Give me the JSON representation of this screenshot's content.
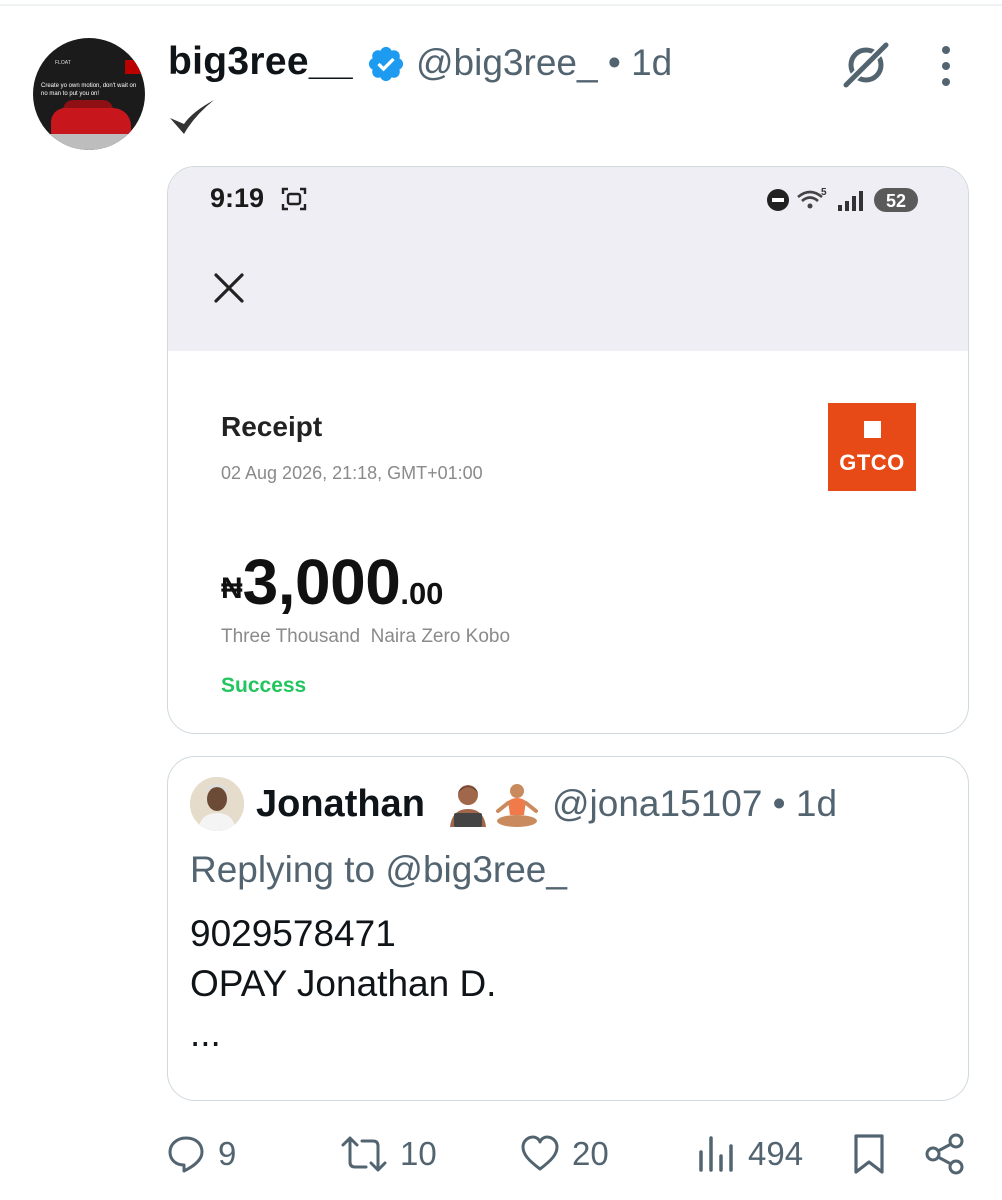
{
  "tweet": {
    "name": "big3ree__",
    "handle_time": "@big3ree_ • 1d",
    "avatar_caption": "Create yo own motion, don't wait on no man to put you on!",
    "avatar_name": "FLOAT"
  },
  "receipt": {
    "phone_time": "9:19",
    "battery": "52",
    "title": "Receipt",
    "date": "02 Aug 2026, 21:18, GMT+01:00",
    "bank_logo": "GTCO",
    "currency_symbol": "₦",
    "amount_major": "3,000",
    "amount_minor": ".00",
    "amount_words": "Three Thousand  Naira Zero Kobo",
    "status": "Success",
    "status_color": "#22c55e"
  },
  "quote": {
    "name": "Jonathan",
    "handle_time": "@jona15107 • 1d",
    "replying_to": "Replying to @big3ree_",
    "line1": "9029578471",
    "line2": "OPAY Jonathan D.",
    "line3": "..."
  },
  "actions": {
    "replies": "9",
    "reposts": "10",
    "likes": "20",
    "views": "494"
  },
  "colors": {
    "verified": "#1d9bf0",
    "secondary_text": "#536471",
    "gtco": "#e84a17"
  }
}
